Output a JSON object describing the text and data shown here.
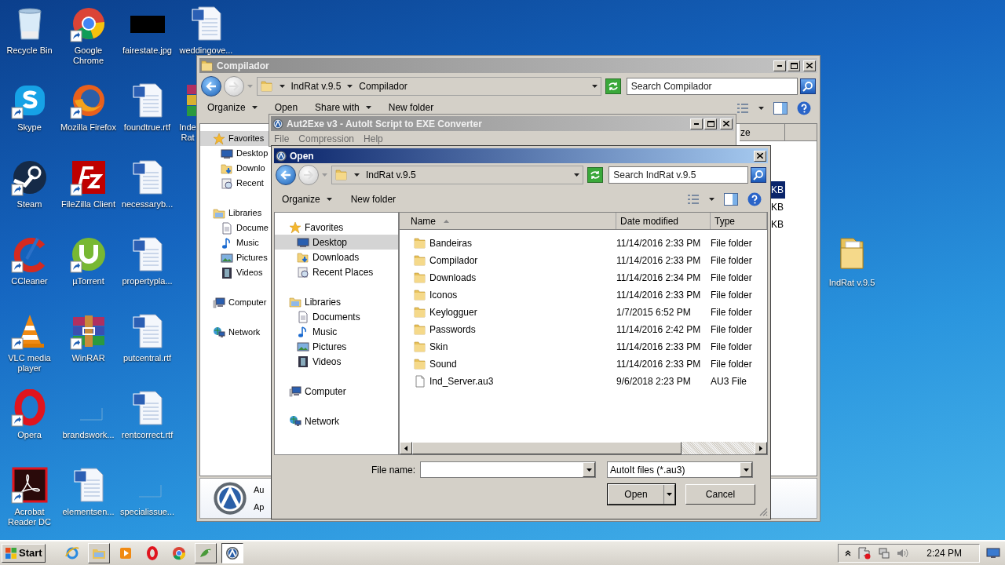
{
  "desktop_columns": [
    [
      {
        "label": "Recycle Bin",
        "kind": "recycle",
        "shortcut": false
      },
      {
        "label": "Skype",
        "kind": "skype",
        "shortcut": true
      },
      {
        "label": "Steam",
        "kind": "steam",
        "shortcut": true
      },
      {
        "label": "CCleaner",
        "kind": "ccleaner",
        "shortcut": true
      },
      {
        "label": "VLC media player",
        "kind": "vlc",
        "shortcut": true
      },
      {
        "label": "Opera",
        "kind": "opera",
        "shortcut": true
      },
      {
        "label": "Acrobat Reader DC",
        "kind": "acrobat",
        "shortcut": true
      }
    ],
    [
      {
        "label": "Google Chrome",
        "kind": "chrome",
        "shortcut": true
      },
      {
        "label": "Mozilla Firefox",
        "kind": "firefox",
        "shortcut": true
      },
      {
        "label": "FileZilla Client",
        "kind": "filezilla",
        "shortcut": true
      },
      {
        "label": "µTorrent",
        "kind": "utorrent",
        "shortcut": true
      },
      {
        "label": "WinRAR",
        "kind": "winrar",
        "shortcut": true
      },
      {
        "label": "brandswork...",
        "kind": "blank",
        "shortcut": false
      },
      {
        "label": "elementsen...",
        "kind": "word",
        "shortcut": false
      }
    ],
    [
      {
        "label": "fairestate.jpg",
        "kind": "image",
        "shortcut": false
      },
      {
        "label": "foundtrue.rtf",
        "kind": "word",
        "shortcut": false
      },
      {
        "label": "necessaryb...",
        "kind": "word",
        "shortcut": false
      },
      {
        "label": "propertypla...",
        "kind": "word",
        "shortcut": false
      },
      {
        "label": "putcentral.rtf",
        "kind": "word",
        "shortcut": false
      },
      {
        "label": "rentcorrect.rtf",
        "kind": "word",
        "shortcut": false
      },
      {
        "label": "specialissue...",
        "kind": "blank",
        "shortcut": false
      }
    ],
    [
      {
        "label": "weddingove...",
        "kind": "word",
        "shortcut": false
      },
      {
        "label": "Inde Rat",
        "kind": "cut",
        "shortcut": false
      }
    ]
  ],
  "desktop_folder": {
    "label": "IndRat v.9.5"
  },
  "explorer": {
    "title": "Compilador",
    "breadcrumbs": [
      "IndRat v.9.5",
      "Compilador"
    ],
    "search_placeholder": "Search Compilador",
    "toolbar": [
      {
        "label": "Organize",
        "menu": true
      },
      {
        "label": "Open",
        "menu": false
      },
      {
        "label": "Share with",
        "menu": true
      },
      {
        "label": "New folder",
        "menu": false
      }
    ],
    "nav": [
      {
        "label": "Favorites",
        "kind": "favorites",
        "selected": true,
        "children": [
          {
            "label": "Desktop",
            "kind": "desktop",
            "selected": false
          },
          {
            "label": "Downlo",
            "kind": "downloads",
            "selected": false
          },
          {
            "label": "Recent",
            "kind": "recent",
            "selected": false
          }
        ]
      },
      {
        "label": "Libraries",
        "kind": "libraries",
        "selected": false,
        "children": [
          {
            "label": "Docume",
            "kind": "documents",
            "selected": false
          },
          {
            "label": "Music",
            "kind": "music",
            "selected": false
          },
          {
            "label": "Pictures",
            "kind": "pictures",
            "selected": false
          },
          {
            "label": "Videos",
            "kind": "videos",
            "selected": false
          }
        ]
      },
      {
        "label": "Computer",
        "kind": "computer",
        "selected": false
      },
      {
        "label": "Network",
        "kind": "network",
        "selected": false
      }
    ],
    "column_header": "ze",
    "size_cells": [
      {
        "text": "KB",
        "selected": true
      },
      {
        "text": "KB",
        "selected": false
      },
      {
        "text": "KB",
        "selected": false
      }
    ],
    "details": {
      "line_1": "Au",
      "line_2": "Ap"
    }
  },
  "aut2exe": {
    "title": "Aut2Exe v3 - AutoIt Script to EXE Converter",
    "menu": [
      "File",
      "Compression",
      "Help"
    ]
  },
  "open_dialog": {
    "title": "Open",
    "breadcrumbs": [
      "IndRat v.9.5"
    ],
    "search_placeholder": "Search IndRat v.9.5",
    "toolbar": [
      {
        "label": "Organize",
        "menu": true
      },
      {
        "label": "New folder",
        "menu": false
      }
    ],
    "nav": [
      {
        "label": "Favorites",
        "kind": "favorites",
        "selected": false,
        "children": [
          {
            "label": "Desktop",
            "kind": "desktop",
            "selected": true
          },
          {
            "label": "Downloads",
            "kind": "downloads",
            "selected": false
          },
          {
            "label": "Recent Places",
            "kind": "recent",
            "selected": false
          }
        ]
      },
      {
        "label": "Libraries",
        "kind": "libraries",
        "selected": false,
        "children": [
          {
            "label": "Documents",
            "kind": "documents",
            "selected": false
          },
          {
            "label": "Music",
            "kind": "music",
            "selected": false
          },
          {
            "label": "Pictures",
            "kind": "pictures",
            "selected": false
          },
          {
            "label": "Videos",
            "kind": "videos",
            "selected": false
          }
        ]
      },
      {
        "label": "Computer",
        "kind": "computer",
        "selected": false
      },
      {
        "label": "Network",
        "kind": "network",
        "selected": false
      }
    ],
    "columns": [
      {
        "label": "Name",
        "sorted": true
      },
      {
        "label": "Date modified",
        "sorted": false
      },
      {
        "label": "Type",
        "sorted": false
      }
    ],
    "files": [
      {
        "name": "Bandeiras",
        "date": "11/14/2016 2:33 PM",
        "type": "File folder",
        "kind": "folder"
      },
      {
        "name": "Compilador",
        "date": "11/14/2016 2:33 PM",
        "type": "File folder",
        "kind": "folder"
      },
      {
        "name": "Downloads",
        "date": "11/14/2016 2:34 PM",
        "type": "File folder",
        "kind": "folder"
      },
      {
        "name": "Iconos",
        "date": "11/14/2016 2:33 PM",
        "type": "File folder",
        "kind": "folder"
      },
      {
        "name": "Keylogguer",
        "date": "1/7/2015 6:52 PM",
        "type": "File folder",
        "kind": "folder"
      },
      {
        "name": "Passwords",
        "date": "11/14/2016 2:42 PM",
        "type": "File folder",
        "kind": "folder"
      },
      {
        "name": "Skin",
        "date": "11/14/2016 2:33 PM",
        "type": "File folder",
        "kind": "folder"
      },
      {
        "name": "Sound",
        "date": "11/14/2016 2:33 PM",
        "type": "File folder",
        "kind": "folder"
      },
      {
        "name": "Ind_Server.au3",
        "date": "9/6/2018 2:23 PM",
        "type": "AU3 File",
        "kind": "file"
      }
    ],
    "file_name_label": "File name:",
    "filter": "AutoIt files (*.au3)",
    "buttons": [
      {
        "label": "Open",
        "kind": "split"
      },
      {
        "label": "Cancel",
        "kind": "plain"
      }
    ]
  },
  "taskbar": {
    "start": "Start",
    "apps": [
      {
        "kind": "ie",
        "running": false,
        "selected": false
      },
      {
        "kind": "explorer",
        "running": true,
        "selected": false
      },
      {
        "kind": "media",
        "running": false,
        "selected": false
      },
      {
        "kind": "opera",
        "running": false,
        "selected": false
      },
      {
        "kind": "chrome",
        "running": false,
        "selected": false
      },
      {
        "kind": "lizard",
        "running": true,
        "selected": false
      },
      {
        "kind": "autoit",
        "running": true,
        "selected": true
      }
    ],
    "clock": "2:24 PM"
  }
}
